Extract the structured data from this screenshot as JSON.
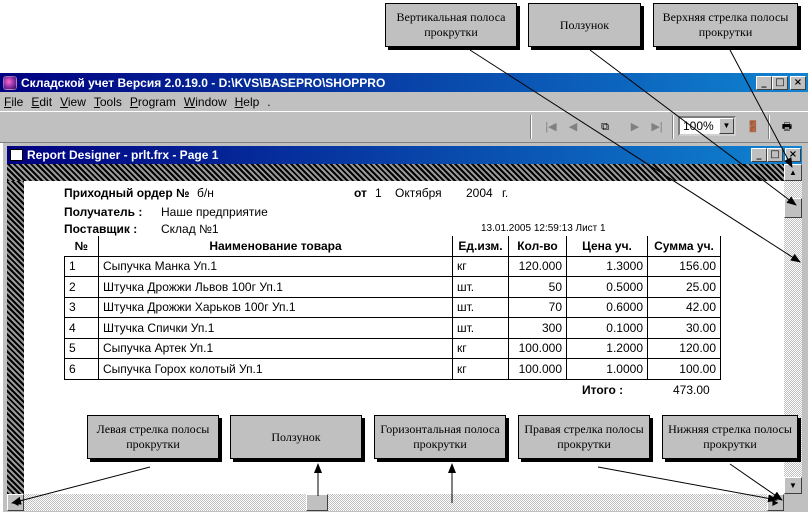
{
  "app": {
    "title": "Складской учет Версия 2.0.19.0 - D:\\KVS\\BASEPRO\\SHOPPRO",
    "controls": {
      "minimize": "_",
      "maximize": "□",
      "close": "×"
    }
  },
  "menu": {
    "items": [
      "File",
      "Edit",
      "View",
      "Tools",
      "Program",
      "Window",
      "Help",
      "."
    ]
  },
  "toolbar": {
    "zoom_value": "100%",
    "icons": [
      "first-page-icon",
      "prev-page-icon",
      "copy-pages-icon",
      "next-page-icon",
      "last-page-icon",
      "exit-icon",
      "print-icon"
    ]
  },
  "report_window": {
    "title": "Report Designer - prlt.frx - Page 1"
  },
  "report": {
    "doc_label": "Приходный ордер №",
    "doc_number": "б/н",
    "date_label": "от",
    "date_day": "1",
    "date_month": "Октября",
    "date_year": "2004",
    "date_suffix": "г.",
    "recipient_label": "Получатель :",
    "recipient": "Наше предприятие",
    "supplier_label": "Поставщик :",
    "supplier": "Склад №1",
    "stamp": "13.01.2005 12:59:13 Лист 1",
    "columns": [
      "№",
      "Наименование товара",
      "Ед.изм.",
      "Кол-во",
      "Цена уч.",
      "Сумма уч."
    ],
    "rows": [
      [
        "1",
        "Сыпучка Манка Уп.1",
        "кг",
        "120.000",
        "1.3000",
        "156.00"
      ],
      [
        "2",
        "Штучка Дрожжи Львов 100г Уп.1",
        "шт.",
        "50",
        "0.5000",
        "25.00"
      ],
      [
        "3",
        "Штучка Дрожжи Харьков 100г Уп.1",
        "шт.",
        "70",
        "0.6000",
        "42.00"
      ],
      [
        "4",
        "Штучка Спички Уп.1",
        "шт.",
        "300",
        "0.1000",
        "30.00"
      ],
      [
        "5",
        "Сыпучка Артек Уп.1",
        "кг",
        "100.000",
        "1.2000",
        "120.00"
      ],
      [
        "6",
        "Сыпучка Горох колотый Уп.1",
        "кг",
        "100.000",
        "1.0000",
        "100.00"
      ]
    ],
    "total_label": "Итого :",
    "total_value": "473.00"
  },
  "callouts": {
    "vertical_scrollbar": "Вертикальная полоса прокрутки",
    "vertical_thumb": "Ползунок",
    "top_arrow": "Верхняя стрелка полосы прокрутки",
    "left_arrow": "Левая стрелка полосы прокрутки",
    "horizontal_thumb": "Ползунок",
    "horizontal_scrollbar": "Горизонтальная полоса прокрутки",
    "right_arrow": "Правая стрелка полосы прокрутки",
    "bottom_arrow": "Нижняя стрелка полосы прокрутки"
  }
}
